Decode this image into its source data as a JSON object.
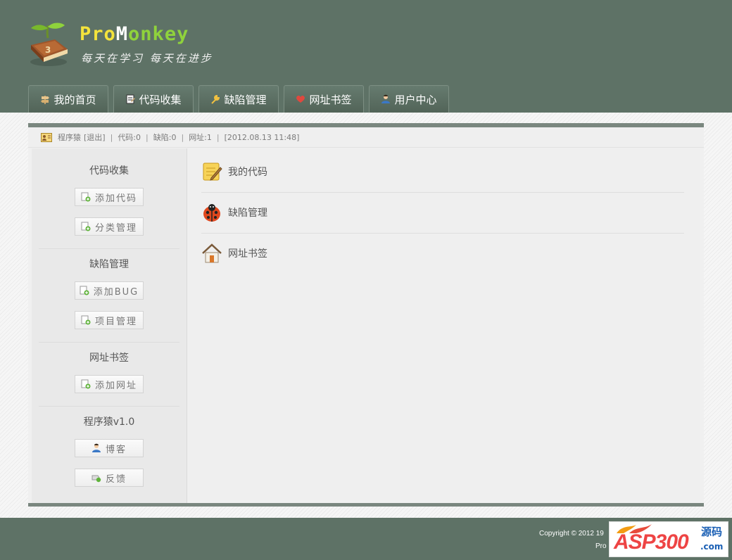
{
  "header": {
    "title_part1": "Pro",
    "title_part2": "M",
    "title_part3": "onkey",
    "slogan": "每天在学习 每天在进步"
  },
  "nav": {
    "tabs": [
      {
        "label": "我的首页",
        "icon": "signpost-icon"
      },
      {
        "label": "代码收集",
        "icon": "notepad-icon"
      },
      {
        "label": "缺陷管理",
        "icon": "wrench-icon"
      },
      {
        "label": "网址书签",
        "icon": "heart-icon"
      },
      {
        "label": "用户中心",
        "icon": "user-icon"
      }
    ]
  },
  "status": {
    "user": "程序猿",
    "logout": "[退出]",
    "code": "代码:0",
    "bug": "缺陷:0",
    "url": "网址:1",
    "datetime": "[2012.08.13 11:48]"
  },
  "sidebar": {
    "sections": [
      {
        "title": "代码收集",
        "buttons": [
          {
            "label": "添加代码"
          },
          {
            "label": "分类管理"
          }
        ]
      },
      {
        "title": "缺陷管理",
        "buttons": [
          {
            "label": "添加BUG"
          },
          {
            "label": "项目管理"
          }
        ]
      },
      {
        "title": "网址书签",
        "buttons": [
          {
            "label": "添加网址"
          }
        ]
      },
      {
        "title": "程序猿v1.0",
        "buttons": [
          {
            "label": "博客"
          },
          {
            "label": "反馈"
          }
        ]
      }
    ]
  },
  "content": {
    "items": [
      {
        "label": "我的代码",
        "icon": "pencil-note-icon"
      },
      {
        "label": "缺陷管理",
        "icon": "ladybug-icon"
      },
      {
        "label": "网址书签",
        "icon": "house-icon"
      }
    ]
  },
  "footer": {
    "copyright": "Copyright © 2012 19",
    "line2": "Pro"
  },
  "watermark": {
    "brand": "ASP300",
    "cn": "源码",
    "domain": ".com"
  },
  "colors": {
    "header_bg": "#5e7266",
    "accent_yellow": "#f4e33c",
    "accent_green": "#8fd23c"
  }
}
